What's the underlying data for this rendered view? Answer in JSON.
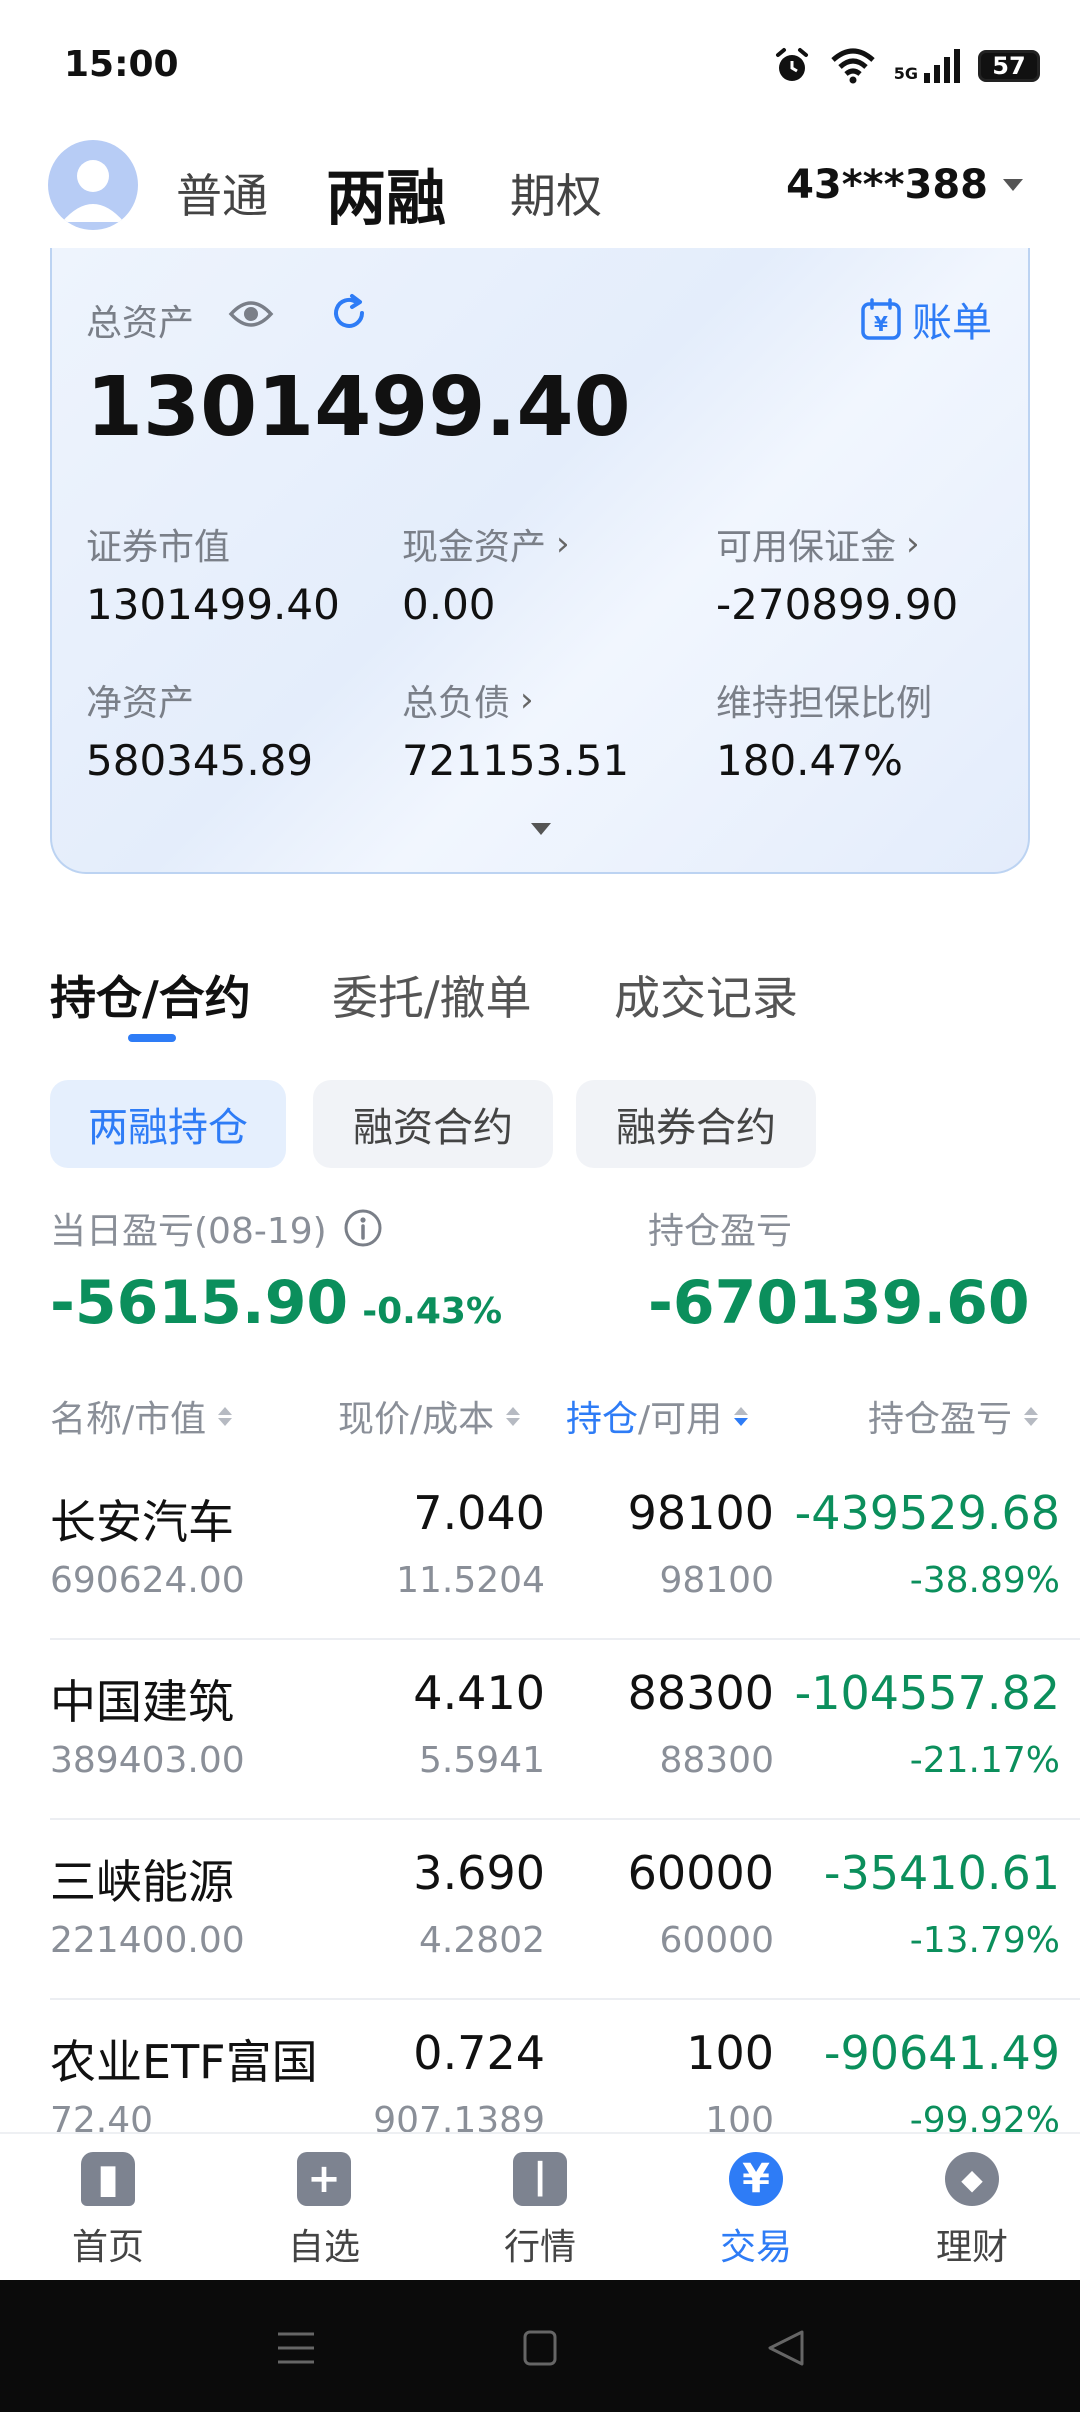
{
  "status": {
    "time": "15:00",
    "network": "5G",
    "battery": "57"
  },
  "account": {
    "tabs": [
      "普通",
      "两融",
      "期权"
    ],
    "active_tab": "两融",
    "id": "43***388"
  },
  "assets": {
    "total_label": "总资产",
    "total_value": "1301499.40",
    "statement_label": "账单",
    "fields": [
      {
        "label": "证券市值",
        "value": "1301499.40",
        "arrow": false
      },
      {
        "label": "现金资产",
        "value": "0.00",
        "arrow": true
      },
      {
        "label": "可用保证金",
        "value": "-270899.90",
        "arrow": true
      },
      {
        "label": "净资产",
        "value": "580345.89",
        "arrow": false
      },
      {
        "label": "总负债",
        "value": "721153.51",
        "arrow": true
      },
      {
        "label": "维持担保比例",
        "value": "180.47%",
        "arrow": false
      }
    ]
  },
  "tabs": [
    "持仓/合约",
    "委托/撤单",
    "成交记录"
  ],
  "chips": [
    "两融持仓",
    "融资合约",
    "融券合约"
  ],
  "pnl": {
    "daily_label": "当日盈亏(08-19)",
    "daily_value": "-5615.90",
    "daily_pct": "-0.43%",
    "holding_label": "持仓盈亏",
    "holding_value": "-670139.60"
  },
  "table": {
    "headers": {
      "name": "名称/市值",
      "price": "现价/成本",
      "hold_a": "持仓",
      "hold_b": "/可用",
      "pl": "持仓盈亏"
    },
    "rows": [
      {
        "name": "长安汽车",
        "mv": "690624.00",
        "price": "7.040",
        "cost": "11.5204",
        "hold": "98100",
        "avail": "98100",
        "pl": "-439529.68",
        "plp": "-38.89%"
      },
      {
        "name": "中国建筑",
        "mv": "389403.00",
        "price": "4.410",
        "cost": "5.5941",
        "hold": "88300",
        "avail": "88300",
        "pl": "-104557.82",
        "plp": "-21.17%"
      },
      {
        "name": "三峡能源",
        "mv": "221400.00",
        "price": "3.690",
        "cost": "4.2802",
        "hold": "60000",
        "avail": "60000",
        "pl": "-35410.61",
        "plp": "-13.79%"
      },
      {
        "name": "农业ETF富国",
        "mv": "72.40",
        "price": "0.724",
        "cost": "907.1389",
        "hold": "100",
        "avail": "100",
        "pl": "-90641.49",
        "plp": "-99.92%"
      }
    ]
  },
  "nav": [
    {
      "label": "首页",
      "icon": "home-icon",
      "glyph": "▮"
    },
    {
      "label": "自选",
      "icon": "plus-icon",
      "glyph": "+"
    },
    {
      "label": "行情",
      "icon": "chart-icon",
      "glyph": "┃"
    },
    {
      "label": "交易",
      "icon": "yen-icon",
      "glyph": "¥"
    },
    {
      "label": "理财",
      "icon": "diamond-icon",
      "glyph": "◆"
    }
  ],
  "colors": {
    "accent": "#2e7cf6",
    "loss": "#0b8f5c"
  }
}
